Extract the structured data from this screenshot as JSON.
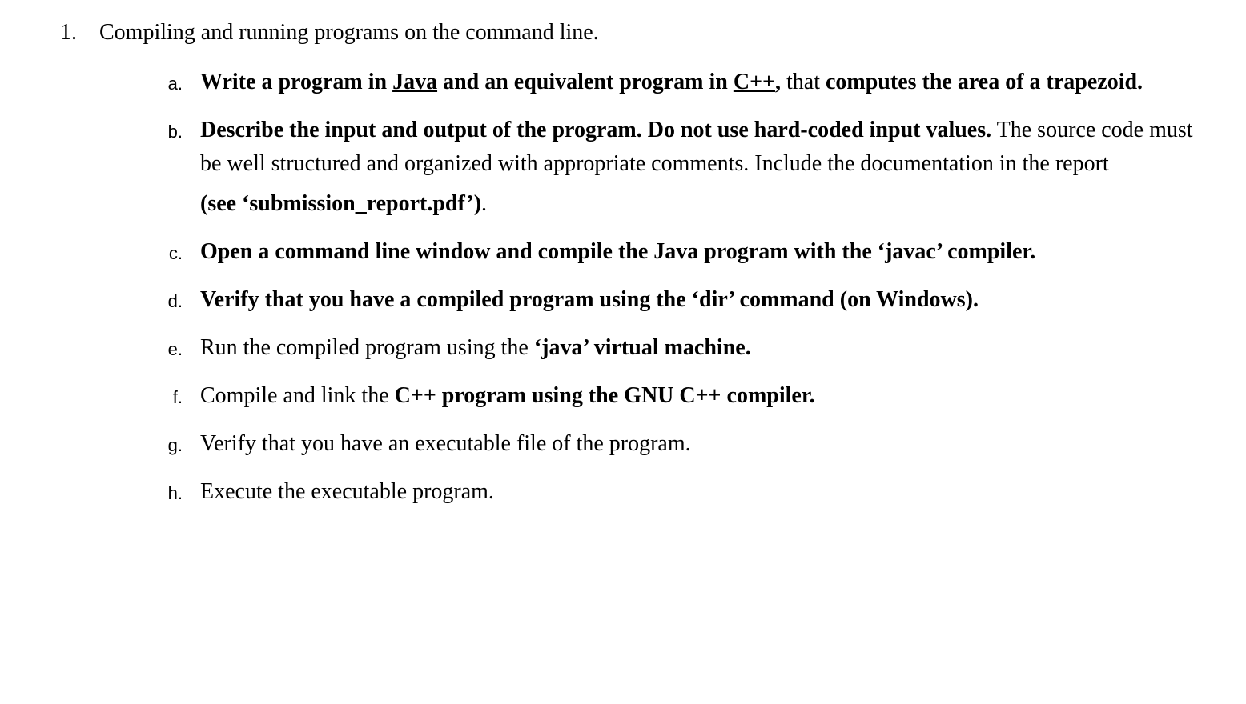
{
  "main": {
    "marker": "1.",
    "heading": "Compiling and running programs on the command line."
  },
  "items": {
    "a": {
      "marker": "a.",
      "p1_bold1": "Write a program in ",
      "p1_java": "Java",
      "p1_bold2": " and an equivalent program in ",
      "p1_cpp": "C++",
      "p1_comma": ",",
      "p1_tail": " that ",
      "p1_bold3": "computes the area of a trapezoid."
    },
    "b": {
      "marker": "b.",
      "p1_bold1": "Describe the input and output of the program. Do not use hard-coded input values.",
      "p1_plain": " The source code must be well structured and organized with appropriate comments. Include the documentation in the report",
      "p2_bold": "(see ‘submission_report.pdf’)",
      "p2_plain": "."
    },
    "c": {
      "marker": "c.",
      "text": "Open a command line window and compile the Java program with the ‘javac’ compiler."
    },
    "d": {
      "marker": "d.",
      "text": "Verify that you have a compiled program using the ‘dir’ command (on Windows)."
    },
    "e": {
      "marker": "e.",
      "plain": "Run the compiled program using the ",
      "bold": "‘java’ virtual machine."
    },
    "f": {
      "marker": "f.",
      "plain": "Compile and link the ",
      "bold": "C++ program using the GNU C++ compiler."
    },
    "g": {
      "marker": "g.",
      "text": "Verify that you have an executable file of the program."
    },
    "h": {
      "marker": "h.",
      "text": "Execute the executable program."
    }
  }
}
